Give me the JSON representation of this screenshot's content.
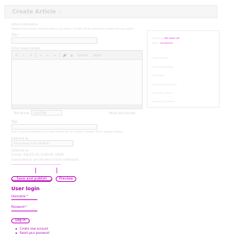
{
  "header": {
    "title": "Create Article",
    "title_suffix": "☆"
  },
  "form": {
    "intro_heading": "Article information",
    "intro_text": "Please fill out the form below to submit your article. The title will be used as the headline for your article.",
    "title_label": "Title *",
    "title_value": "",
    "content_label": "Article body content",
    "toolbar": [
      "B",
      "I",
      "U",
      "≡",
      "≡",
      "≡",
      "🔗",
      "▣",
      "Format",
      "Styles"
    ],
    "text_format_label": "Text format",
    "text_format_value": "Full HTML",
    "text_format_help": "About text formats",
    "tags_label": "Tags",
    "tags_help": "Enter a comma-separated list of words to describe your content. Example: funny, bungee jumping",
    "author_label": "Authored by",
    "author_value": "Anonymous (not verified)",
    "authored_on_label": "Authored on",
    "authored_on_help": "Format: 2024-01-01 12:00:00 +0000",
    "tz_note": "Leave blank to use the time of form submission.",
    "save_label": "Save and publish",
    "preview_label": "Preview"
  },
  "sidebar": {
    "status_label": "Last saved:",
    "status_value": "Not saved yet",
    "author_label": "Author:",
    "author_value": "Anonymous",
    "links": [
      "▸ Menu settings",
      "▸ Comment settings",
      "▸ URL alias",
      "▸ Authoring information",
      "▸ Promotion options",
      "▸ Revision information"
    ]
  },
  "login": {
    "title": "User login",
    "username_label": "Username *",
    "password_label": "Password *",
    "login_button": "Log in",
    "links": [
      "Create new account",
      "Reset your password"
    ]
  }
}
